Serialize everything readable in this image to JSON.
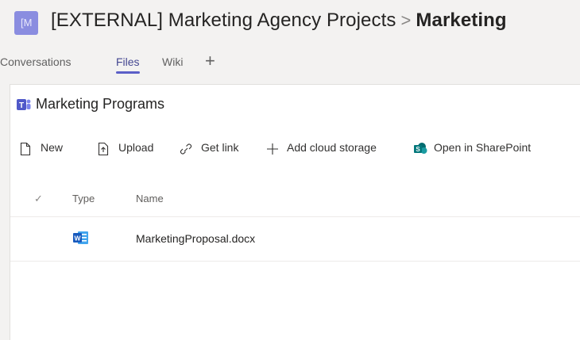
{
  "header": {
    "team_initial": "[M",
    "team_name": "[EXTERNAL] Marketing Agency Projects",
    "separator": ">",
    "channel_name": "Marketing"
  },
  "tabs": [
    {
      "label": "Conversations",
      "active": false
    },
    {
      "label": "Files",
      "active": true
    },
    {
      "label": "Wiki",
      "active": false
    }
  ],
  "tab_add": "+",
  "library": {
    "title": "Marketing Programs"
  },
  "toolbar": {
    "new_label": "New",
    "upload_label": "Upload",
    "get_link_label": "Get link",
    "add_cloud_label": "Add cloud storage",
    "sharepoint_label": "Open in SharePoint"
  },
  "table": {
    "check_symbol": "✓",
    "columns": [
      "Type",
      "Name"
    ],
    "rows": [
      {
        "type_icon": "word-icon",
        "name": "MarketingProposal.docx"
      }
    ]
  },
  "colors": {
    "accent": "#5b5fc7",
    "team_avatar": "#8a8de0",
    "word_blue": "#185abd"
  }
}
